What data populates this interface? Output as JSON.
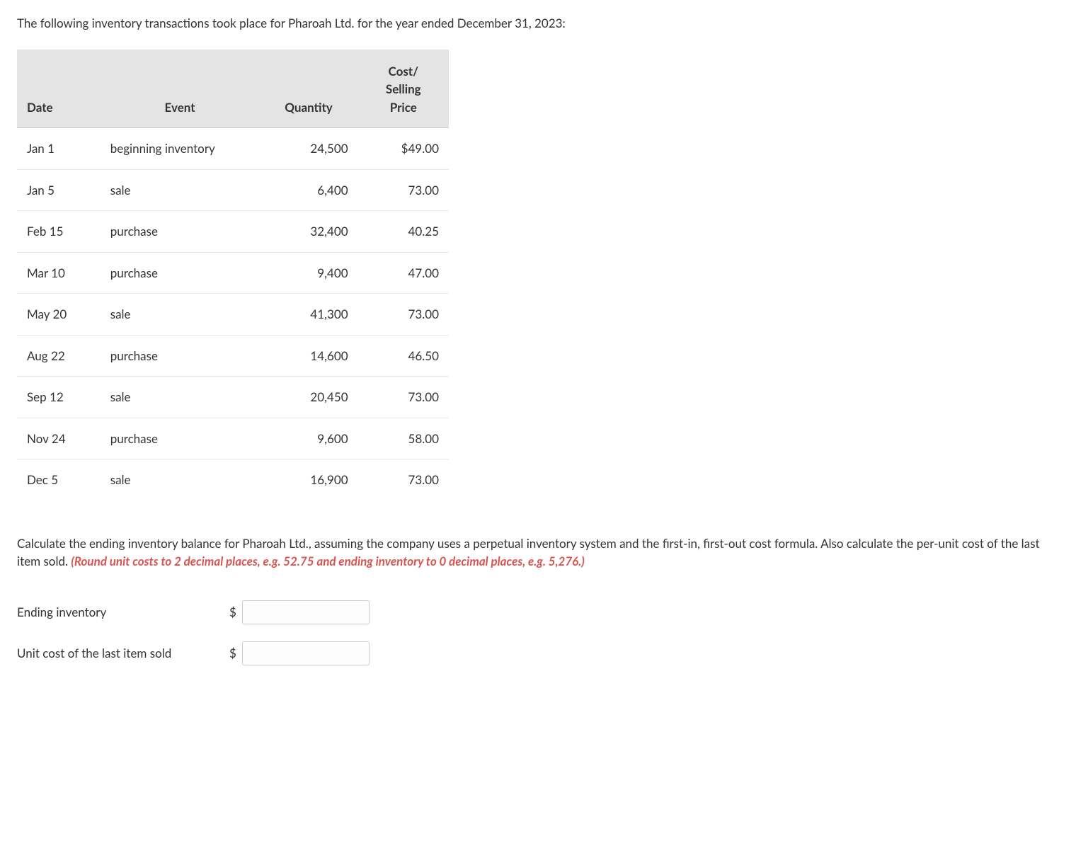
{
  "intro": "The following inventory transactions took place for Pharoah Ltd. for the year ended December 31, 2023:",
  "table": {
    "headers": {
      "date": "Date",
      "event": "Event",
      "quantity": "Quantity",
      "price_line1": "Cost/",
      "price_line2": "Selling",
      "price_line3": "Price"
    },
    "rows": [
      {
        "date": "Jan 1",
        "event": "beginning inventory",
        "quantity": "24,500",
        "price": "$49.00"
      },
      {
        "date": "Jan 5",
        "event": "sale",
        "quantity": "6,400",
        "price": "73.00"
      },
      {
        "date": "Feb 15",
        "event": "purchase",
        "quantity": "32,400",
        "price": "40.25"
      },
      {
        "date": "Mar 10",
        "event": "purchase",
        "quantity": "9,400",
        "price": "47.00"
      },
      {
        "date": "May 20",
        "event": "sale",
        "quantity": "41,300",
        "price": "73.00"
      },
      {
        "date": "Aug 22",
        "event": "purchase",
        "quantity": "14,600",
        "price": "46.50"
      },
      {
        "date": "Sep 12",
        "event": "sale",
        "quantity": "20,450",
        "price": "73.00"
      },
      {
        "date": "Nov 24",
        "event": "purchase",
        "quantity": "9,600",
        "price": "58.00"
      },
      {
        "date": "Dec 5",
        "event": "sale",
        "quantity": "16,900",
        "price": "73.00"
      }
    ]
  },
  "instruction": {
    "text": "Calculate the ending inventory balance for Pharoah Ltd., assuming the company uses a perpetual inventory system and the first-in, first-out cost formula. Also calculate the per-unit cost of the last item sold. ",
    "red": "(Round unit costs to 2 decimal places, e.g. 52.75 and ending inventory to 0 decimal places, e.g. 5,276.)"
  },
  "answers": {
    "ending_label": "Ending inventory",
    "unitcost_label": "Unit cost of the last item sold",
    "dollar": "$",
    "ending_value": "",
    "unitcost_value": ""
  }
}
